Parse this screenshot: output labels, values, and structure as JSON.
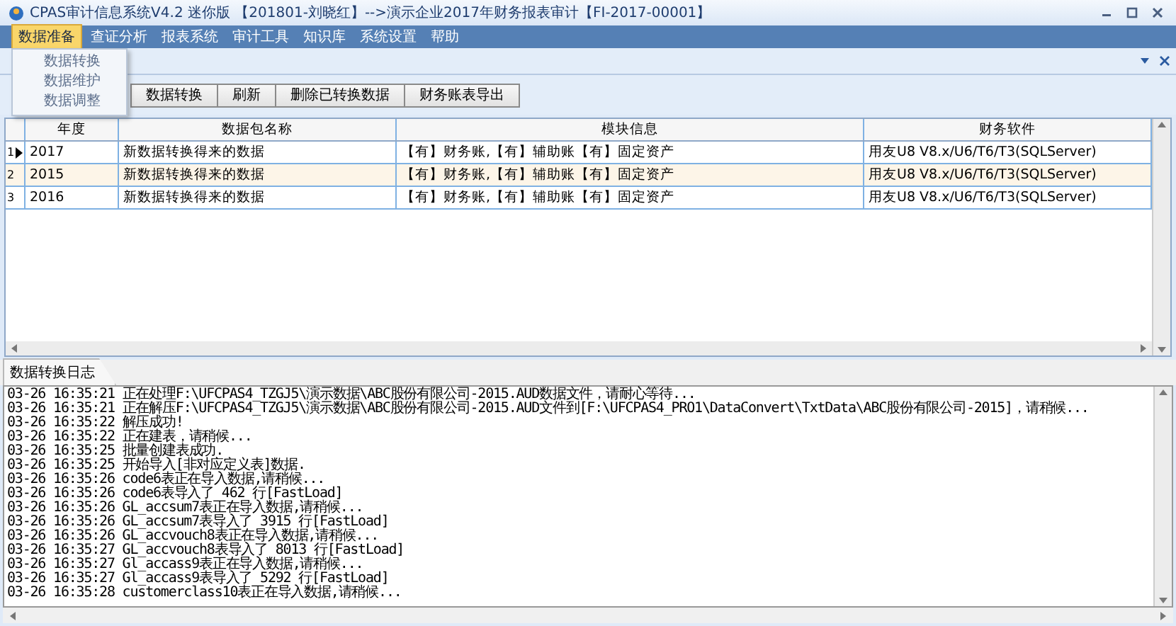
{
  "window": {
    "title": "CPAS审计信息系统V4.2 迷你版 【201801-刘晓红】-->演示企业2017年财务报表审计【FI-2017-00001】"
  },
  "menu": [
    {
      "label": "数据准备",
      "selected": true
    },
    {
      "label": "查证分析",
      "selected": false
    },
    {
      "label": "报表系统",
      "selected": false
    },
    {
      "label": "审计工具",
      "selected": false
    },
    {
      "label": "知识库",
      "selected": false
    },
    {
      "label": "系统设置",
      "selected": false
    },
    {
      "label": "帮助",
      "selected": false
    }
  ],
  "dropdown": [
    "数据转换",
    "数据维护",
    "数据调整"
  ],
  "toolbar": [
    "数据转换",
    "刷新",
    "删除已转换数据",
    "财务账表导出"
  ],
  "table": {
    "columns": [
      "年度",
      "数据包名称",
      "模块信息",
      "财务软件"
    ],
    "rows": [
      {
        "number": "1",
        "selected": true,
        "cells": [
          "2017",
          "新数据转换得来的数据",
          "【有】财务账,【有】辅助账【有】固定资产",
          "用友U8 V8.x/U6/T6/T3(SQLServer)"
        ]
      },
      {
        "number": "2",
        "selected": false,
        "cells": [
          "2015",
          "新数据转换得来的数据",
          "【有】财务账,【有】辅助账【有】固定资产",
          "用友U8 V8.x/U6/T6/T3(SQLServer)"
        ]
      },
      {
        "number": "3",
        "selected": false,
        "cells": [
          "2016",
          "新数据转换得来的数据",
          "【有】财务账,【有】辅助账【有】固定资产",
          "用友U8 V8.x/U6/T6/T3(SQLServer)"
        ]
      }
    ]
  },
  "log": {
    "tab": "数据转换日志",
    "lines": [
      "03-26 16:35:21 正在处理F:\\UFCPAS4_TZGJ5\\演示数据\\ABC股份有限公司-2015.AUD数据文件，请耐心等待...",
      "03-26 16:35:21 正在解压F:\\UFCPAS4_TZGJ5\\演示数据\\ABC股份有限公司-2015.AUD文件到[F:\\UFCPAS4_PRO1\\DataConvert\\TxtData\\ABC股份有限公司-2015]，请稍候...",
      "03-26 16:35:22 解压成功!",
      "03-26 16:35:22 正在建表，请稍候...",
      "03-26 16:35:25 批量创建表成功.",
      "03-26 16:35:25 开始导入[非对应定义表]数据.",
      "03-26 16:35:26 code6表正在导入数据,请稍候...",
      "03-26 16:35:26 code6表导入了 462 行[FastLoad]",
      "03-26 16:35:26 GL_accsum7表正在导入数据,请稍候...",
      "03-26 16:35:26 GL_accsum7表导入了 3915 行[FastLoad]",
      "03-26 16:35:26 GL_accvouch8表正在导入数据,请稍候...",
      "03-26 16:35:27 GL_accvouch8表导入了 8013 行[FastLoad]",
      "03-26 16:35:27 Gl_accass9表正在导入数据,请稍候...",
      "03-26 16:35:27 Gl_accass9表导入了 5292 行[FastLoad]",
      "03-26 16:35:28 customerclass10表正在导入数据,请稍候..."
    ]
  }
}
